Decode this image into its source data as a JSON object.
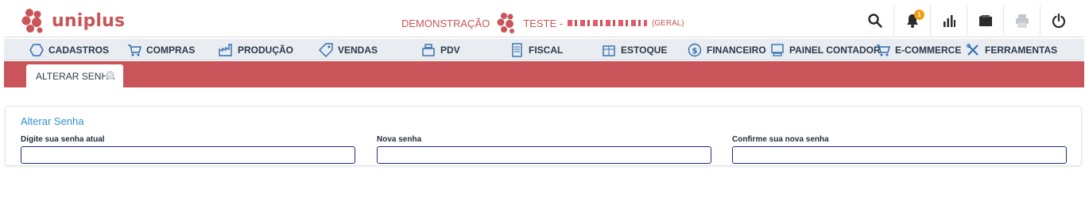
{
  "header": {
    "logo_text": "uniplus",
    "mode_label": "DEMONSTRAÇÃO",
    "company_name": "TESTE -",
    "company_scope": "(GERAL)",
    "notification_count": "1"
  },
  "menu": {
    "items": [
      {
        "label": "CADASTROS",
        "icon": "hexagon-icon"
      },
      {
        "label": "COMPRAS",
        "icon": "cart-icon"
      },
      {
        "label": "PRODUÇÃO",
        "icon": "factory-icon"
      },
      {
        "label": "VENDAS",
        "icon": "tag-icon"
      },
      {
        "label": "PDV",
        "icon": "register-icon"
      },
      {
        "label": "FISCAL",
        "icon": "document-icon"
      },
      {
        "label": "ESTOQUE",
        "icon": "box-icon"
      },
      {
        "label": "FINANCEIRO",
        "icon": "dollar-icon"
      },
      {
        "label": "PAINEL CONTADOR",
        "icon": "monitor-icon"
      },
      {
        "label": "E-COMMERCE",
        "icon": "cart-icon"
      },
      {
        "label": "FERRAMENTAS",
        "icon": "tools-icon"
      }
    ]
  },
  "tabs": [
    {
      "label": "ALTERAR SENHA"
    }
  ],
  "form": {
    "title": "Alterar Senha",
    "fields": [
      {
        "label": "Digite sua senha atual",
        "value": ""
      },
      {
        "label": "Nova senha",
        "value": ""
      },
      {
        "label": "Confirme sua nova senha",
        "value": ""
      }
    ]
  },
  "colors": {
    "brand": "#c9555a",
    "accent_blue": "#2f8fd1",
    "badge": "#f39c12"
  }
}
